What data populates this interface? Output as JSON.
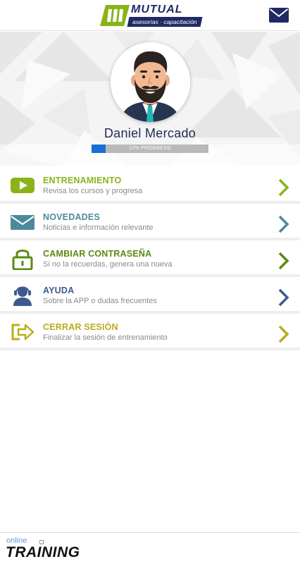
{
  "header": {
    "logo_word": "MUTUAL",
    "logo_sub": "asesorías · capacitación",
    "icon": "mail-icon"
  },
  "profile": {
    "name": "Daniel Mercado",
    "progress_fraction": 0.12,
    "progress_label": "12% PROGRESO"
  },
  "menu": [
    {
      "title": "ENTRENAMIENTO",
      "desc": "Revisa los cursos y progresa",
      "icon": "youtube-play-icon",
      "color": "#8ab31a"
    },
    {
      "title": "NOVEDADES",
      "desc": "Noticias e información relevante",
      "icon": "envelope-icon",
      "color": "#4b8a9c"
    },
    {
      "title": "CAMBIAR CONTRASEÑA",
      "desc": "Si no la recuerdas, genera una nueva",
      "icon": "lock-icon",
      "color": "#5a8a12"
    },
    {
      "title": "AYUDA",
      "desc": "Sobre la APP o dudas frecuentes",
      "icon": "support-agent-icon",
      "color": "#3c5a8e"
    },
    {
      "title": "CERRAR SESIÓN",
      "desc": "Finalizar la sesión de entrenamiento",
      "icon": "sign-out-icon",
      "color": "#b9ad1a"
    }
  ],
  "footer": {
    "online": "online",
    "training": "TRAINING"
  }
}
